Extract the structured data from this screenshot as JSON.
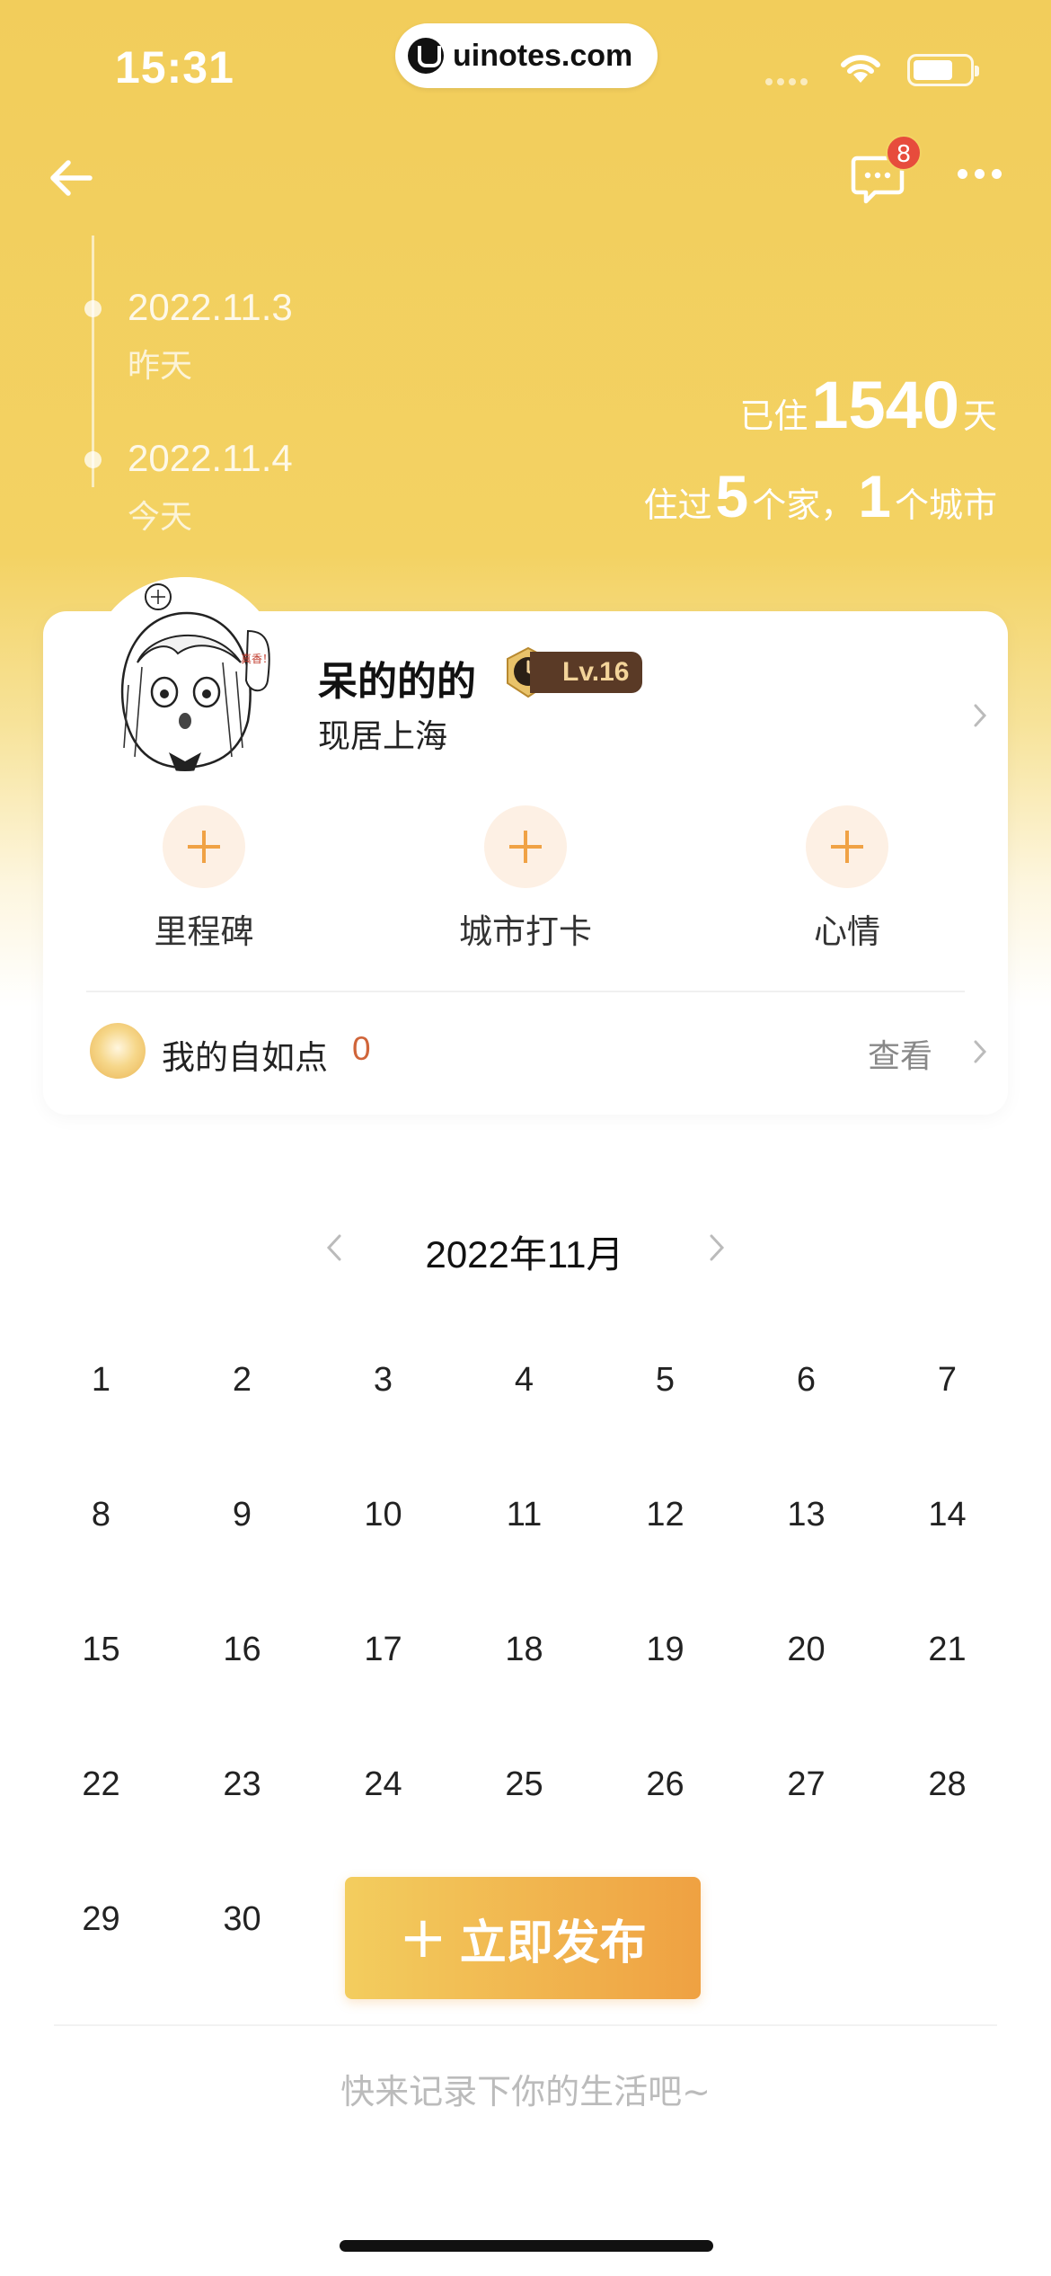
{
  "status_bar": {
    "time": "15:31",
    "url": "uinotes.com"
  },
  "nav": {
    "back_icon": "arrow-left-icon",
    "message_icon": "chat-bubble-icon",
    "message_badge": "8",
    "more_icon": "more-dots-icon"
  },
  "timeline": [
    {
      "date": "2022.11.3",
      "label": "昨天"
    },
    {
      "date": "2022.11.4",
      "label": "今天"
    }
  ],
  "stats": {
    "lived_prefix": "已住",
    "lived_days": "1540",
    "lived_suffix": "天",
    "homes_prefix": "住过",
    "homes_count": "5",
    "homes_suffix": "个家，",
    "cities_count": "1",
    "cities_suffix": "个城市"
  },
  "profile": {
    "username": "呆的的的",
    "level": "Lv.16",
    "location": "现居上海",
    "avatar_bubble": "真香！"
  },
  "actions": [
    {
      "label": "里程碑"
    },
    {
      "label": "城市打卡"
    },
    {
      "label": "心情"
    }
  ],
  "points": {
    "label": "我的自如点",
    "value": "0",
    "view_label": "查看"
  },
  "calendar": {
    "title": "2022年11月",
    "days": [
      [
        "1",
        "2",
        "3",
        "4",
        "5",
        "6",
        "7"
      ],
      [
        "8",
        "9",
        "10",
        "11",
        "12",
        "13",
        "14"
      ],
      [
        "15",
        "16",
        "17",
        "18",
        "19",
        "20",
        "21"
      ],
      [
        "22",
        "23",
        "24",
        "25",
        "26",
        "27",
        "28"
      ],
      [
        "29",
        "30"
      ]
    ]
  },
  "publish": {
    "label": "立即发布",
    "plus": "+"
  },
  "hint": "快来记录下你的生活吧~",
  "colors": {
    "header_yellow": "#f2cd5b",
    "accent_orange": "#f0a245",
    "points_red": "#d0653a",
    "level_brown": "#5a3a26"
  }
}
